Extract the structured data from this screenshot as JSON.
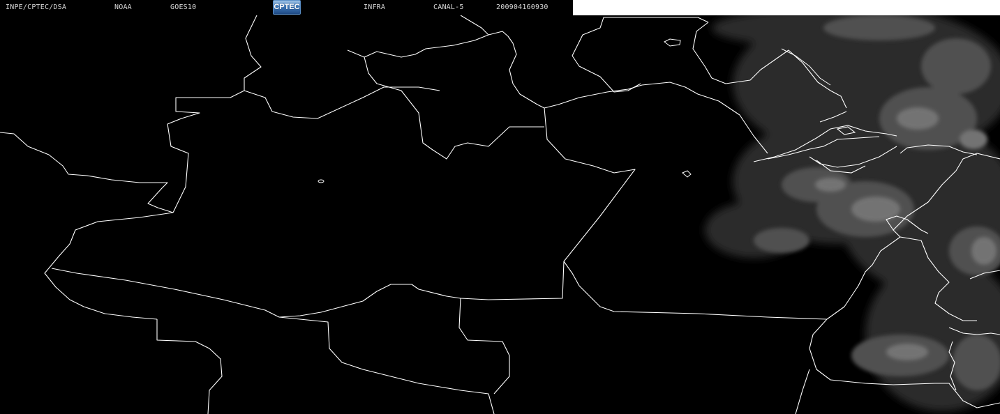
{
  "header": {
    "institution": "INPE/CPTEC/DSA",
    "agency": "NOAA",
    "satellite": "GOES10",
    "logo_text": "CPTEC",
    "band": "INFRA",
    "channel": "CANAL-5",
    "timestamp": "200904160930"
  },
  "colors": {
    "background": "#000000",
    "boundary": "#ffffff",
    "cloud": "#8a8a8a",
    "header_text": "#d8d8d8"
  },
  "layers": {
    "imagery": "infrared satellite imagery",
    "boundaries": "political boundaries"
  }
}
